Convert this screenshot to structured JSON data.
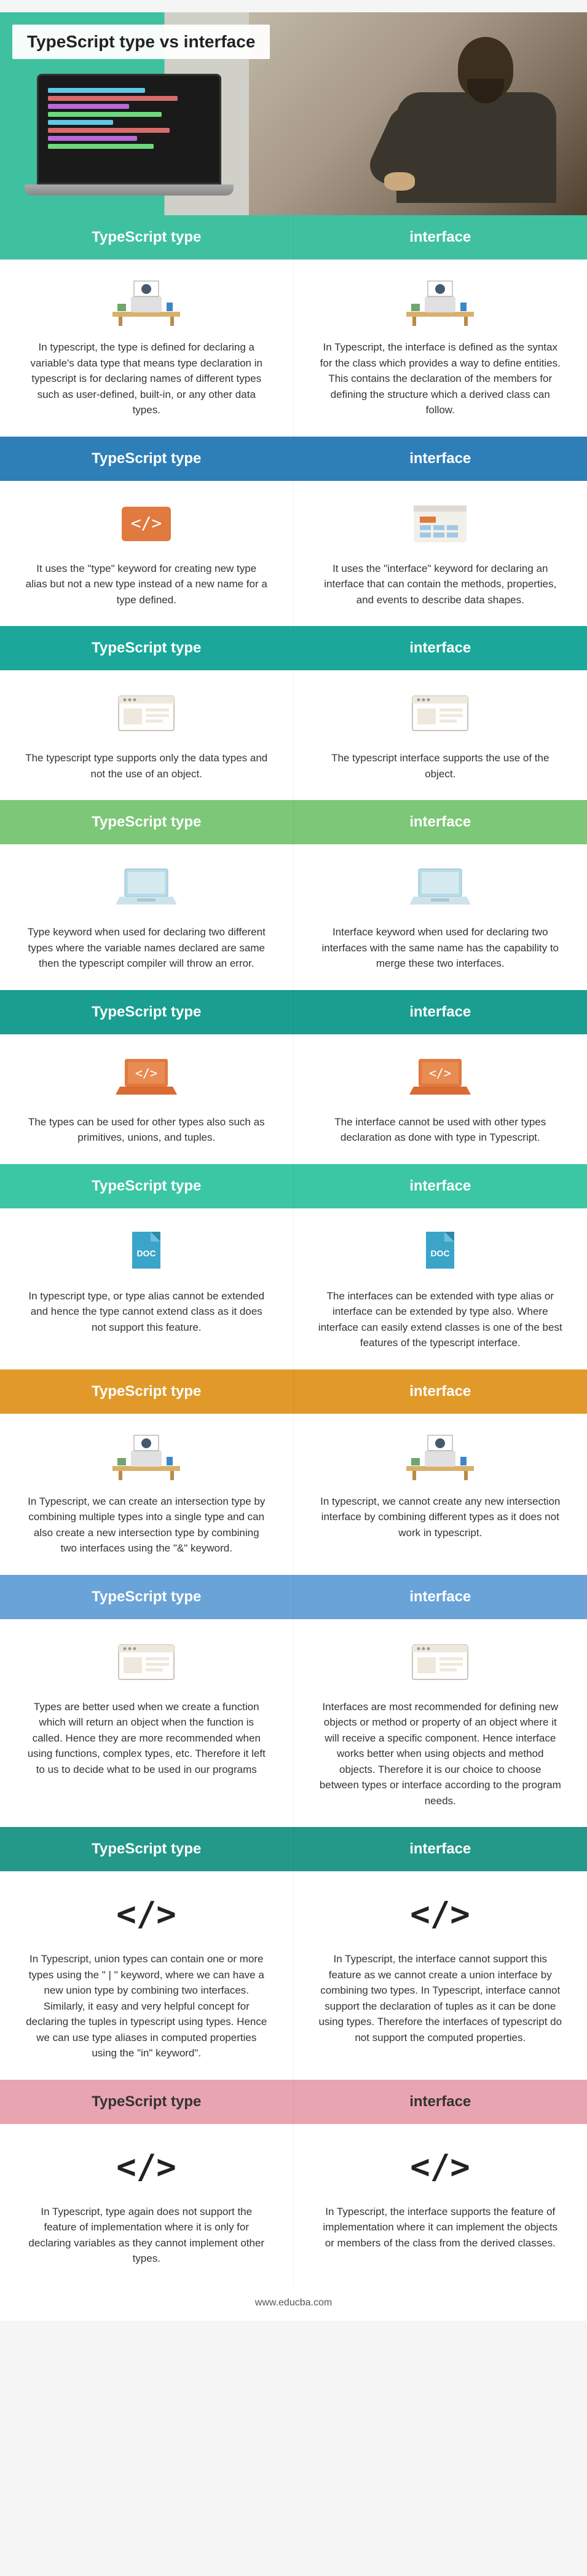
{
  "page_title": "TypeScript type vs interface",
  "footer_url": "www.educba.com",
  "columns": {
    "left": "TypeScript type",
    "right": "interface"
  },
  "rows": [
    {
      "header_class": "c-green",
      "icon": "desk",
      "left": "In typescript, the type is defined for declaring a variable's data type that means type declaration in typescript is for declaring names of different types such as user-defined, built-in, or any other data types.",
      "right": "In Typescript, the interface is defined as the syntax for the class which provides a way to define entities. This contains the declaration of the members for defining the structure which a derived class can follow."
    },
    {
      "header_class": "c-blue",
      "icon": "code-window",
      "left": "It uses the \"type\" keyword for creating new type alias but not a new type instead of a new name for a type defined.",
      "right": "It uses the \"interface\" keyword for declaring an interface that can contain the methods, properties, and events to describe data shapes."
    },
    {
      "header_class": "c-teal",
      "icon": "browser",
      "left": "The typescript type supports only the data types and not the use of an object.",
      "right": "The typescript interface supports the use of the object."
    },
    {
      "header_class": "c-green-l",
      "icon": "laptop-blue",
      "left": "Type keyword when used for declaring two different types where the variable names declared are same then the typescript compiler will throw an error.",
      "right": "Interface keyword when used for declaring two interfaces with the same name has the capability to merge these two interfaces."
    },
    {
      "header_class": "c-teal-d",
      "icon": "laptop-orange",
      "left": "The types can be used for other types also such as primitives, unions, and tuples.",
      "right": "The interface cannot be used with other types declaration as done with type in Typescript."
    },
    {
      "header_class": "c-mint",
      "icon": "doc",
      "left": "In typescript type, or type alias cannot be extended and hence the type cannot extend class as it does not support this feature.",
      "right": "The interfaces can be extended with type alias or interface can be extended by type also. Where interface can easily extend classes is one of the best features of the typescript interface."
    },
    {
      "header_class": "c-orange",
      "icon": "desk",
      "left": "In Typescript, we can create an intersection type by combining multiple types into a single type and can also create a new intersection type by combining two interfaces using the \"&\" keyword.",
      "right": "In typescript, we cannot create any new intersection interface by combining different types as it does not work in typescript."
    },
    {
      "header_class": "c-sky",
      "icon": "browser",
      "left": "Types are better used when we create a function which will return an object when the function is called. Hence they are more recommended when using functions, complex types, etc. Therefore it left to us to decide what to be used in our programs",
      "right": "Interfaces are most recommended for defining new objects or method or property of an object where it will receive a specific component. Hence interface works better when using objects and method objects. Therefore it is our choice to choose between types or interface according to the program needs."
    },
    {
      "header_class": "c-teal-g",
      "icon": "code-brackets",
      "left": "In Typescript, union types can contain one or more types using the \" | \" keyword, where we can have a new union type by combining two interfaces. Similarly, it easy and very helpful concept for declaring the tuples in typescript using types. Hence we can use type aliases in computed properties using the \"in\" keyword\".",
      "right": "In Typescript, the interface cannot support this feature as we cannot create a union interface by combining two types. In Typescript, interface cannot support the declaration of tuples as it can be done using types. Therefore the interfaces of typescript do not support the computed properties."
    },
    {
      "header_class": "c-pink",
      "icon": "code-brackets",
      "left": "In Typescript, type again does not support the feature of implementation where it is only for declaring variables as they cannot implement other types.",
      "right": "In Typescript, the interface supports the feature of implementation where it can implement the objects or members of the class from the derived classes."
    }
  ],
  "chart_data": {
    "type": "table",
    "title": "TypeScript type vs interface",
    "columns": [
      "TypeScript type",
      "interface"
    ],
    "rows": [
      [
        "Type defines variable data types; declares names of user-defined, built-in, or other types.",
        "Interface defines class syntax; declares members for structure a derived class can follow."
      ],
      [
        "Uses 'type' keyword; creates alias, not new type.",
        "Uses 'interface' keyword; contains methods, properties, events describing data shapes."
      ],
      [
        "Supports only data types, not object use.",
        "Supports use of the object."
      ],
      [
        "Same-name type declarations throw error.",
        "Same-name interfaces merge."
      ],
      [
        "Can be used for primitives, unions, tuples.",
        "Cannot be used with other type declarations."
      ],
      [
        "Type alias cannot be extended; cannot extend class.",
        "Interfaces can be extended by type alias or type; can extend classes."
      ],
      [
        "Can create intersection type via '&' combining types/interfaces.",
        "Cannot create intersection interface by combining types."
      ],
      [
        "Better for functions returning objects, complex types.",
        "Better for defining new objects, methods, properties."
      ],
      [
        "Union types via '|'; tuples easy; computed props via 'in'.",
        "Cannot create union interface; no tuple support; no computed properties."
      ],
      [
        "Does not support implementation; only declares variables.",
        "Supports implementation of objects/members from derived classes."
      ]
    ]
  }
}
